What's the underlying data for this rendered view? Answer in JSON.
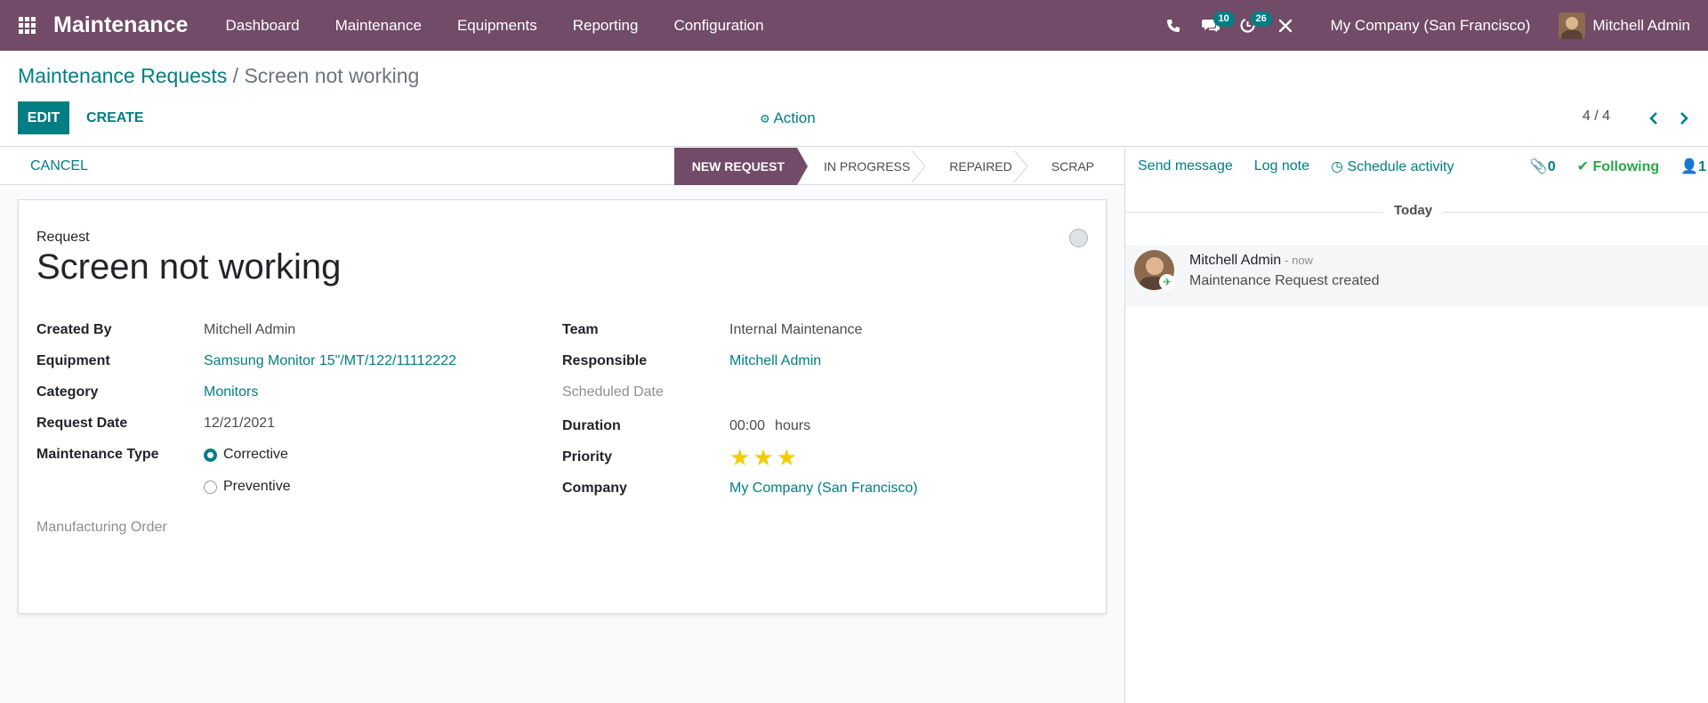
{
  "navbar": {
    "app_name": "Maintenance",
    "menu": [
      "Dashboard",
      "Maintenance",
      "Equipments",
      "Reporting",
      "Configuration"
    ],
    "messages_count": "10",
    "activities_count": "26",
    "company": "My Company (San Francisco)",
    "user": "Mitchell Admin"
  },
  "breadcrumb": {
    "parent": "Maintenance Requests",
    "separator": " / ",
    "current": "Screen not working"
  },
  "toolbar": {
    "edit_label": "EDIT",
    "create_label": "CREATE",
    "action_label": "Action",
    "pager": "4 / 4"
  },
  "statusbar": {
    "cancel_label": "CANCEL",
    "stages": [
      "NEW REQUEST",
      "IN PROGRESS",
      "REPAIRED",
      "SCRAP"
    ],
    "active_stage": "NEW REQUEST"
  },
  "form": {
    "request_label": "Request",
    "title": "Screen not working",
    "left": {
      "created_by": {
        "label": "Created By",
        "value": "Mitchell Admin"
      },
      "equipment": {
        "label": "Equipment",
        "value": "Samsung Monitor 15\"/MT/122/11112222"
      },
      "category": {
        "label": "Category",
        "value": "Monitors"
      },
      "request_date": {
        "label": "Request Date",
        "value": "12/21/2021"
      },
      "maintenance_type": {
        "label": "Maintenance Type",
        "options": [
          "Corrective",
          "Preventive"
        ],
        "selected": "Corrective"
      },
      "manufacturing_order": {
        "label": "Manufacturing Order"
      }
    },
    "right": {
      "team": {
        "label": "Team",
        "value": "Internal Maintenance"
      },
      "responsible": {
        "label": "Responsible",
        "value": "Mitchell Admin"
      },
      "scheduled_date": {
        "label": "Scheduled Date"
      },
      "duration": {
        "label": "Duration",
        "value": "00:00",
        "unit": "hours"
      },
      "priority": {
        "label": "Priority",
        "stars": 3,
        "max_stars": 3
      },
      "company": {
        "label": "Company",
        "value": "My Company (San Francisco)"
      }
    }
  },
  "chatter": {
    "send_message": "Send message",
    "log_note": "Log note",
    "schedule_activity": "Schedule activity",
    "attachments": "0",
    "following": "Following",
    "followers": "1",
    "date_separator": "Today",
    "messages": [
      {
        "author": "Mitchell Admin",
        "time": "- now",
        "body": "Maintenance Request created"
      }
    ]
  },
  "colors": {
    "brand": "#714b67",
    "accent": "#017e84",
    "star": "#f3cc00"
  }
}
